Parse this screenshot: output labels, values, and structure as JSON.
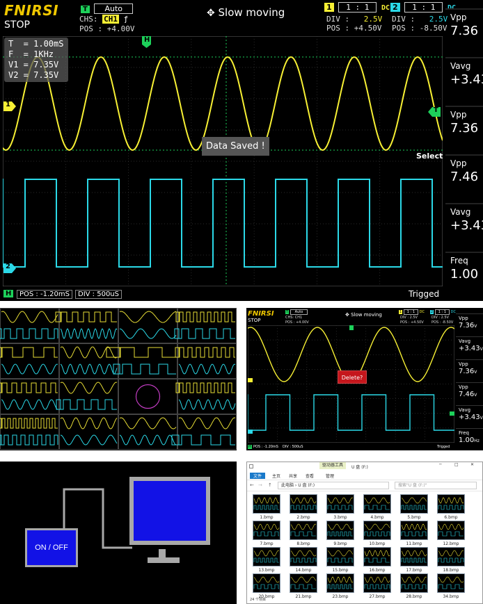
{
  "scope_main": {
    "brand": "FNIRSI",
    "run_state": "STOP",
    "trigger_badge": "T",
    "trigger_mode": "Auto",
    "chs_label": "CHS:",
    "chs_value": "CH1",
    "chs_edge": "ƒ",
    "trig_pos": "POS : +4.00V",
    "move_icon": "move-arrows-icon",
    "move_label": "Slow moving",
    "ch1": {
      "badge": "1",
      "probe": "1 : 1",
      "coupling": "DC",
      "div_label": "DIV :",
      "div": "2.5V",
      "pos_label": "POS :",
      "pos": "+4.50V",
      "color": "#f7f034"
    },
    "ch2": {
      "badge": "2",
      "probe": "1 : 1",
      "coupling": "DC",
      "div_label": "DIV :",
      "div": "2.5V",
      "pos_label": "POS :",
      "pos": "-8.50V",
      "color": "#2bd9e8"
    },
    "readout": [
      "T  = 1.00mS",
      "F  = 1KHz",
      "V1 = 7.35V",
      "V2 = 7.35V"
    ],
    "toast": "Data Saved !",
    "select_label": "Select",
    "marker_h": "H",
    "marker_ch1": "1",
    "marker_ch2": "2",
    "marker_t": "T",
    "bottom": {
      "h_badge": "H",
      "pos": "POS : -1.20mS",
      "div": "DIV : 500uS",
      "status": "Trigged"
    },
    "measurements": [
      {
        "name": "Vpp",
        "value": "7.36"
      },
      {
        "name": "Vavg",
        "value": "+3.43"
      },
      {
        "name": "Vpp",
        "value": "7.36"
      },
      {
        "name": "Vpp",
        "value": "7.46"
      },
      {
        "name": "Vavg",
        "value": "+3.43"
      },
      {
        "name": "Freq",
        "value": "1.00"
      }
    ]
  },
  "scope_small": {
    "brand": "FNIRSI",
    "run_state": "STOP",
    "trigger_badge": "T",
    "trigger_mode": "Auto",
    "chs": "CHS: CH1",
    "trig_pos": "POS : +4.00V",
    "move_label": "Slow moving",
    "ch1": {
      "badge": "1",
      "probe": "1 : 1",
      "coupling": "DC",
      "div": "DIV : 2.5V",
      "pos": "POS : +4.50V"
    },
    "ch2": {
      "badge": "2",
      "probe": "1 : 1",
      "coupling": "DC",
      "div": "DIV : 2.5V",
      "pos": "POS : -8.50V"
    },
    "dialog": "Delete?",
    "bottom": {
      "h_badge": "H",
      "pos": "POS : -1.20mS",
      "div": "DIV : 500uS",
      "status": "Trigged"
    },
    "measurements": [
      {
        "name": "Vpp",
        "value": "7.36",
        "unit": "V"
      },
      {
        "name": "Vavg",
        "value": "+3.43",
        "unit": "V"
      },
      {
        "name": "Vpp",
        "value": "7.36",
        "unit": "V"
      },
      {
        "name": "Vpp",
        "value": "7.46",
        "unit": "V"
      },
      {
        "name": "Vavg",
        "value": "+3.43",
        "unit": "V"
      },
      {
        "name": "Freq",
        "value": "1.00",
        "unit": "Hz"
      }
    ]
  },
  "usb": {
    "button": "ON / OFF"
  },
  "explorer": {
    "tab_tools": "驱动器工具",
    "window_title": "U 盘 (F:)",
    "ribbon": [
      "文件",
      "主页",
      "共享",
      "查看",
      "管理"
    ],
    "path": "此电脑 › U 盘 (F:)",
    "search_placeholder": "搜索\"U 盘 (F:)\"",
    "files": [
      "1.bmp",
      "2.bmp",
      "3.bmp",
      "4.bmp",
      "5.bmp",
      "6.bmp",
      "7.bmp",
      "8.bmp",
      "9.bmp",
      "10.bmp",
      "11.bmp",
      "12.bmp",
      "13.bmp",
      "14.bmp",
      "15.bmp",
      "16.bmp",
      "17.bmp",
      "18.bmp",
      "20.bmp",
      "21.bmp",
      "23.bmp",
      "27.bmp",
      "28.bmp",
      "34.bmp"
    ],
    "status": "24 个项目"
  }
}
